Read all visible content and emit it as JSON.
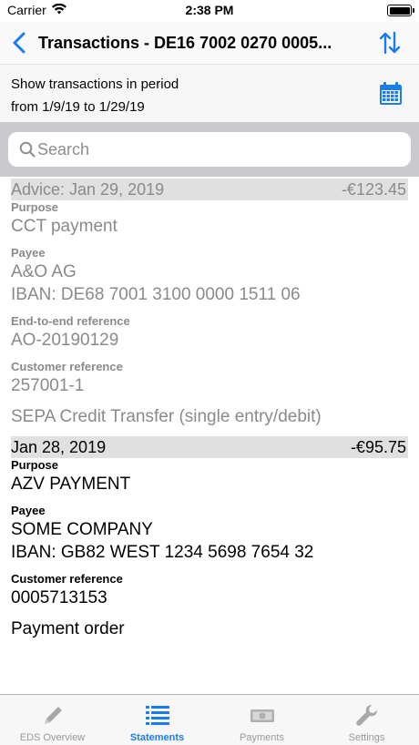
{
  "status_bar": {
    "carrier": "Carrier",
    "time": "2:38 PM"
  },
  "nav": {
    "title": "Transactions - DE16 7002 0270 0005..."
  },
  "period": {
    "label": "Show transactions in period",
    "range": "from 1/9/19 to 1/29/19"
  },
  "search": {
    "placeholder": "Search"
  },
  "transactions": [
    {
      "date": "Advice: Jan 29, 2019",
      "amount": "-€123.45",
      "purpose_label": "Purpose",
      "purpose": "CCT payment",
      "payee_label": "Payee",
      "payee_name": "A&O AG",
      "payee_iban": "IBAN: DE68 7001 3100 0000 1511 06",
      "e2e_label": "End-to-end reference",
      "e2e": "AO-20190129",
      "customer_ref_label": "Customer reference",
      "customer_ref": "257001-1",
      "type": "SEPA Credit Transfer (single entry/debit)"
    },
    {
      "date": "Jan 28, 2019",
      "amount": "-€95.75",
      "purpose_label": "Purpose",
      "purpose": "AZV PAYMENT",
      "payee_label": "Payee",
      "payee_name": "SOME COMPANY",
      "payee_iban": "IBAN: GB82 WEST 1234 5698 7654 32",
      "customer_ref_label": "Customer reference",
      "customer_ref": "0005713153",
      "type": "Payment order"
    }
  ],
  "tabs": [
    {
      "label": "EDS Overview",
      "icon": "pencil-icon",
      "active": false
    },
    {
      "label": "Statements",
      "icon": "list-icon",
      "active": true
    },
    {
      "label": "Payments",
      "icon": "banknote-icon",
      "active": false
    },
    {
      "label": "Settings",
      "icon": "wrench-icon",
      "active": false
    }
  ],
  "colors": {
    "accent": "#1a7cf4",
    "inactive_tab": "#999999",
    "pending_text": "#8a8a8a",
    "header_bg": "#e0e0e0",
    "search_area_bg": "#c9c9ce"
  }
}
